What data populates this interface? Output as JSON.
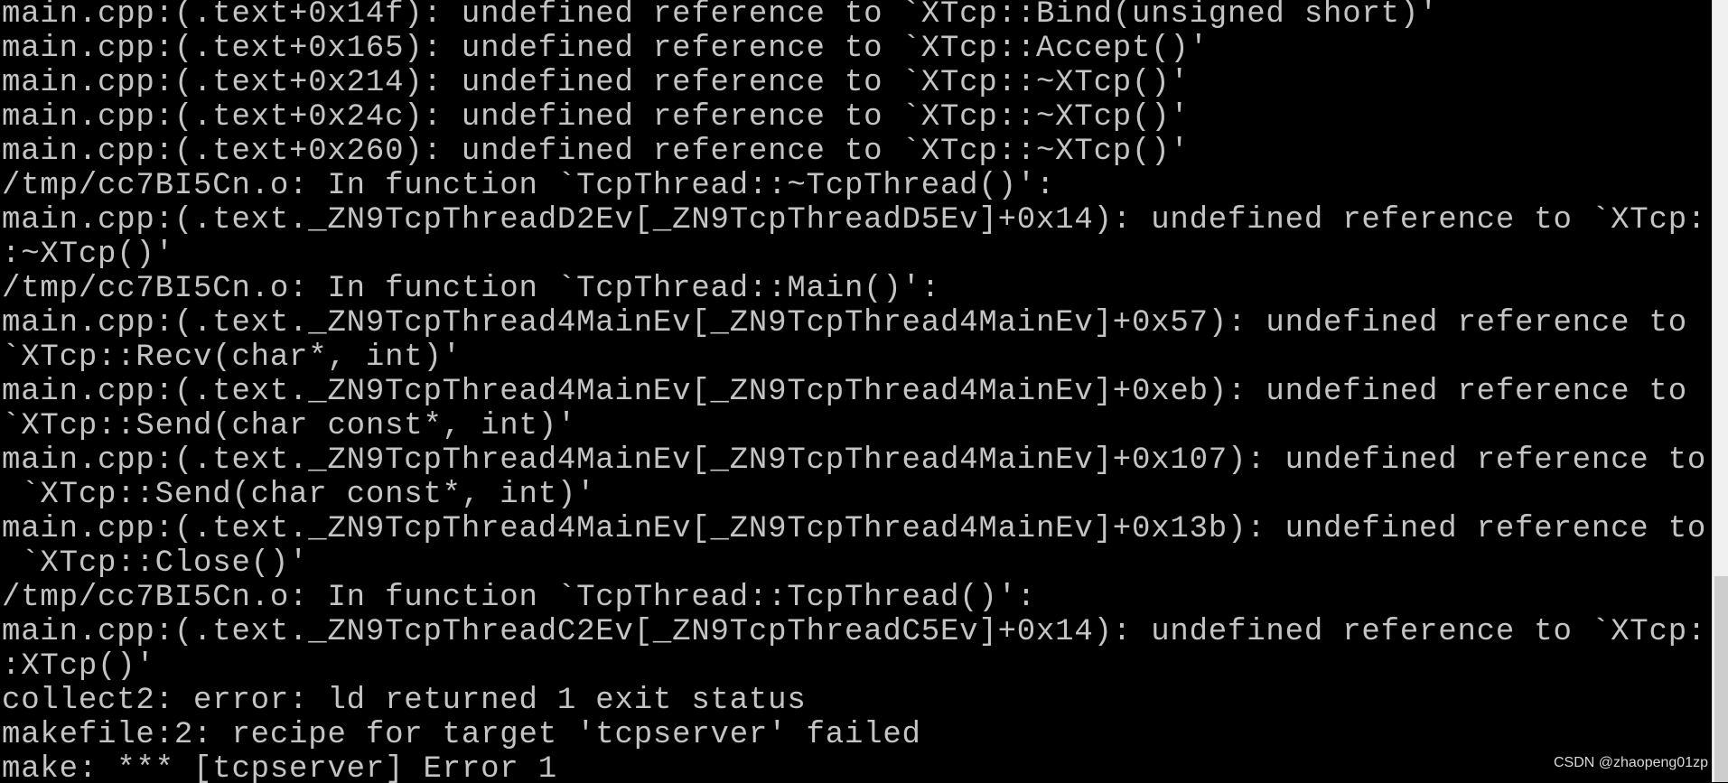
{
  "terminal": {
    "lines": [
      "main.cpp:(.text+0x14f): undefined reference to `XTcp::Bind(unsigned short)'",
      "main.cpp:(.text+0x165): undefined reference to `XTcp::Accept()'",
      "main.cpp:(.text+0x214): undefined reference to `XTcp::~XTcp()'",
      "main.cpp:(.text+0x24c): undefined reference to `XTcp::~XTcp()'",
      "main.cpp:(.text+0x260): undefined reference to `XTcp::~XTcp()'",
      "/tmp/cc7BI5Cn.o: In function `TcpThread::~TcpThread()':",
      "main.cpp:(.text._ZN9TcpThreadD2Ev[_ZN9TcpThreadD5Ev]+0x14): undefined reference to `XTcp:",
      ":~XTcp()'",
      "/tmp/cc7BI5Cn.o: In function `TcpThread::Main()':",
      "main.cpp:(.text._ZN9TcpThread4MainEv[_ZN9TcpThread4MainEv]+0x57): undefined reference to",
      "`XTcp::Recv(char*, int)'",
      "main.cpp:(.text._ZN9TcpThread4MainEv[_ZN9TcpThread4MainEv]+0xeb): undefined reference to",
      "`XTcp::Send(char const*, int)'",
      "main.cpp:(.text._ZN9TcpThread4MainEv[_ZN9TcpThread4MainEv]+0x107): undefined reference to",
      " `XTcp::Send(char const*, int)'",
      "main.cpp:(.text._ZN9TcpThread4MainEv[_ZN9TcpThread4MainEv]+0x13b): undefined reference to",
      " `XTcp::Close()'",
      "/tmp/cc7BI5Cn.o: In function `TcpThread::TcpThread()':",
      "main.cpp:(.text._ZN9TcpThreadC2Ev[_ZN9TcpThreadC5Ev]+0x14): undefined reference to `XTcp:",
      ":XTcp()'",
      "collect2: error: ld returned 1 exit status",
      "makefile:2: recipe for target 'tcpserver' failed",
      "make: *** [tcpserver] Error 1"
    ]
  },
  "watermark": "CSDN @zhaopeng01zp",
  "colors": {
    "background": "#000000",
    "text": "#c4c4c4",
    "scrollbar": "#f0f0f0",
    "scroll_thumb": "#cdcdcd"
  }
}
